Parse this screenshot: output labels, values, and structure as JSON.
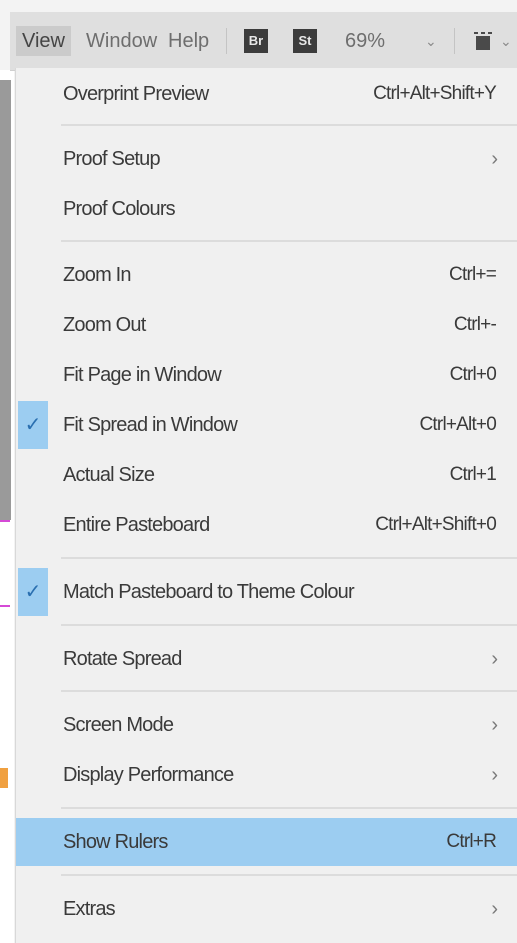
{
  "menubar": {
    "items": [
      {
        "label": "View"
      },
      {
        "label": "Window"
      },
      {
        "label": "Help"
      }
    ],
    "bridge_badge": "Br",
    "stock_badge": "St",
    "zoom": "69%",
    "zoom_caret": "⌄",
    "screen_caret": "⌄"
  },
  "menu": {
    "overprint_preview": {
      "label": "Overprint Preview",
      "shortcut": "Ctrl+Alt+Shift+Y"
    },
    "proof_setup": {
      "label": "Proof Setup",
      "arrow": "›"
    },
    "proof_colours": {
      "label": "Proof Colours"
    },
    "zoom_in": {
      "label": "Zoom In",
      "shortcut": "Ctrl+="
    },
    "zoom_out": {
      "label": "Zoom Out",
      "shortcut": "Ctrl+-"
    },
    "fit_page": {
      "label": "Fit Page in Window",
      "shortcut": "Ctrl+0"
    },
    "fit_spread": {
      "label": "Fit Spread in Window",
      "shortcut": "Ctrl+Alt+0",
      "checked": true,
      "check": "✓"
    },
    "actual_size": {
      "label": "Actual Size",
      "shortcut": "Ctrl+1"
    },
    "entire_pasteboard": {
      "label": "Entire Pasteboard",
      "shortcut": "Ctrl+Alt+Shift+0"
    },
    "match_pasteboard": {
      "label": "Match Pasteboard to Theme Colour",
      "checked": true,
      "check": "✓"
    },
    "rotate_spread": {
      "label": "Rotate Spread",
      "arrow": "›"
    },
    "screen_mode": {
      "label": "Screen Mode",
      "arrow": "›"
    },
    "display_performance": {
      "label": "Display Performance",
      "arrow": "›"
    },
    "show_rulers": {
      "label": "Show Rulers",
      "shortcut": "Ctrl+R",
      "highlighted": true
    },
    "extras": {
      "label": "Extras",
      "arrow": "›"
    }
  },
  "colors": {
    "highlight": "#9ccdf1",
    "check": "#2a6fb0",
    "menu_bg": "#f0f0f0",
    "menubar_bg": "#dfdfdf"
  }
}
